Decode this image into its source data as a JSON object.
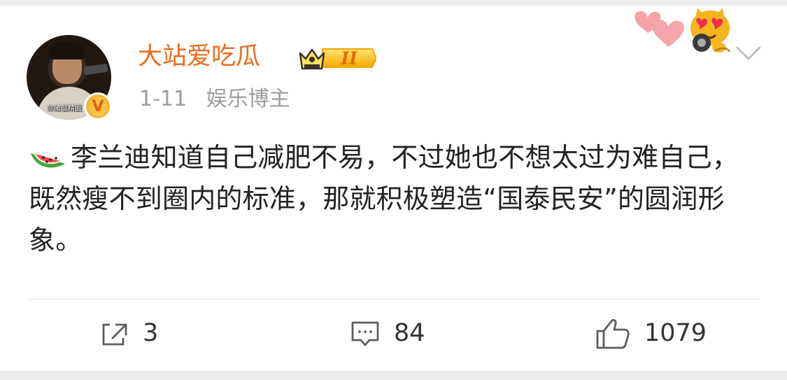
{
  "post": {
    "author": {
      "name": "大站爱吃瓜",
      "avatar_caption": "你確個精面",
      "verified_badge": "V",
      "member_badge": "II"
    },
    "meta": {
      "date": "1-11",
      "source": "娱乐博主"
    },
    "content": {
      "emoji": "watermelon-emoji",
      "text": "李兰迪知道自己减肥不易，不过她也不想太过为难自己，既然瘦不到圈内的标准，那就积极塑造“国泰民安”的圆润形象。"
    }
  },
  "actions": {
    "repost": {
      "icon": "repost-icon",
      "count": "3"
    },
    "comment": {
      "icon": "comment-icon",
      "count": "84"
    },
    "like": {
      "icon": "thumbs-up-icon",
      "count": "1079"
    }
  },
  "colors": {
    "username": "#eb6c1d",
    "meta": "#9d9d9d",
    "text": "#222222",
    "divider": "#e4e4e4",
    "page_gap": "#ededed"
  }
}
